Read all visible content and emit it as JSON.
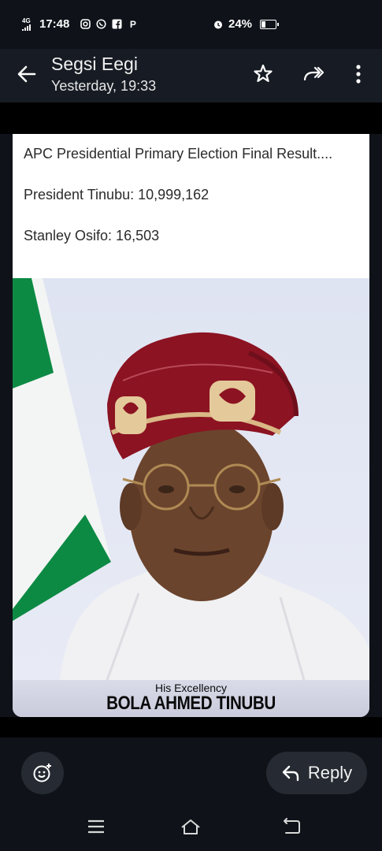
{
  "status_bar": {
    "network": "4G",
    "time": "17:48",
    "app_icons": [
      "instagram-icon",
      "whatsapp-icon",
      "facebook-icon",
      "p-icon"
    ],
    "p_glyph": "P",
    "battery_percent": "24%",
    "battery_level": 0.24
  },
  "header": {
    "sender": "Segsi Eegi",
    "timestamp": "Yesterday, 19:33"
  },
  "message": {
    "lines": [
      "APC Presidential Primary Election Final Result....",
      "President Tinubu: 10,999,162",
      "Stanley Osifo: 16,503"
    ]
  },
  "image": {
    "caption_top": "His Excellency",
    "caption_name": "BOLA AHMED TINUBU"
  },
  "footer": {
    "reply_label": "Reply"
  },
  "colors": {
    "background": "#0f1319",
    "appbar": "#171c24",
    "flag_green": "#0c8a44",
    "cap_red": "#8c1322"
  }
}
